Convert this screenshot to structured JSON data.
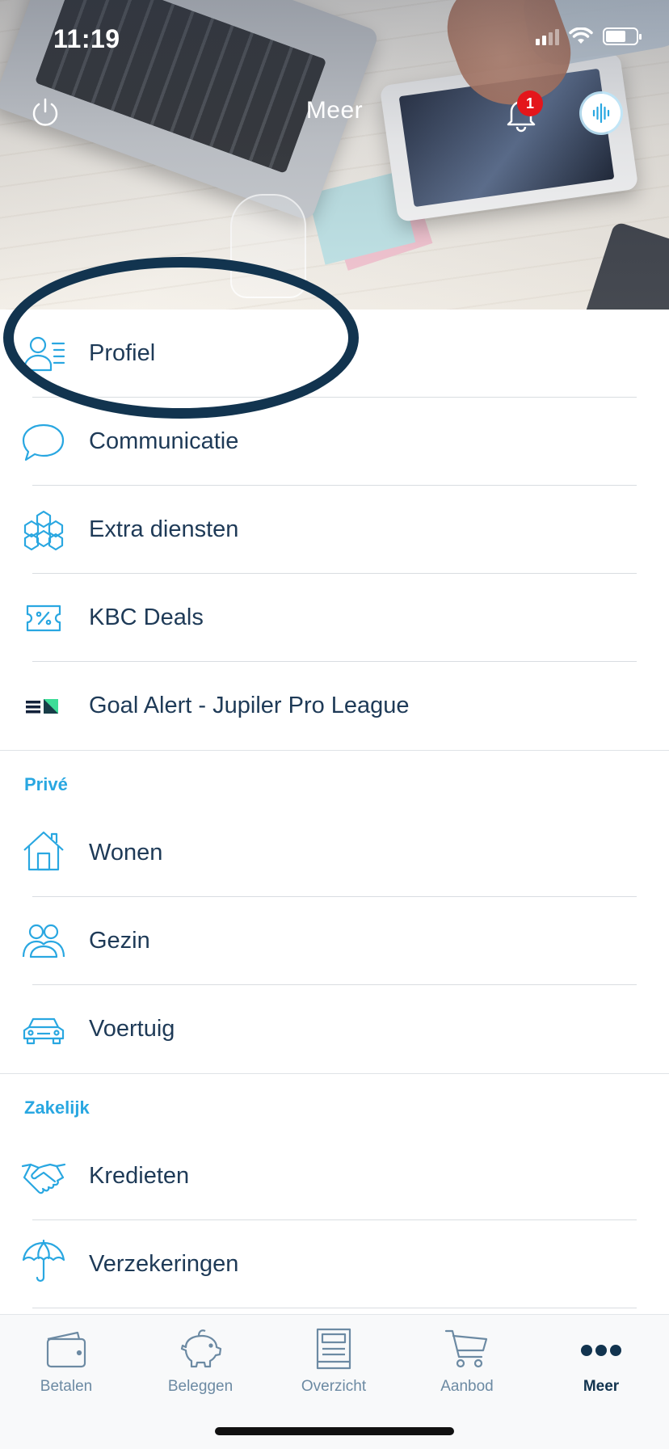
{
  "status_bar": {
    "time": "11:19"
  },
  "header": {
    "title": "Meer",
    "notification_count": "1",
    "icons": {
      "power": "power-icon",
      "bell": "bell-icon",
      "voice": "voice-assistant-icon"
    }
  },
  "menu": {
    "items": [
      {
        "label": "Profiel",
        "icon": "profile-icon"
      },
      {
        "label": "Communicatie",
        "icon": "chat-bubble-icon"
      },
      {
        "label": "Extra diensten",
        "icon": "hexagons-icon"
      },
      {
        "label": "KBC Deals",
        "icon": "coupon-percent-icon"
      },
      {
        "label": "Goal Alert - Jupiler Pro League",
        "icon": "goal-alert-logo-icon"
      }
    ]
  },
  "prive": {
    "heading": "Privé",
    "items": [
      {
        "label": "Wonen",
        "icon": "house-icon"
      },
      {
        "label": "Gezin",
        "icon": "family-icon"
      },
      {
        "label": "Voertuig",
        "icon": "car-icon"
      }
    ]
  },
  "zakelijk": {
    "heading": "Zakelijk",
    "items": [
      {
        "label": "Kredieten",
        "icon": "handshake-icon"
      },
      {
        "label": "Verzekeringen",
        "icon": "umbrella-icon"
      }
    ]
  },
  "tabbar": {
    "tabs": [
      {
        "label": "Betalen",
        "icon": "wallet-icon"
      },
      {
        "label": "Beleggen",
        "icon": "piggy-bank-icon"
      },
      {
        "label": "Overzicht",
        "icon": "overview-document-icon"
      },
      {
        "label": "Aanbod",
        "icon": "cart-icon"
      },
      {
        "label": "Meer",
        "icon": "more-dots-icon",
        "active": true
      }
    ]
  },
  "colors": {
    "accent": "#29a7e1",
    "text": "#1e3a57",
    "highlight": "#12344f",
    "badge": "#e4161b"
  }
}
